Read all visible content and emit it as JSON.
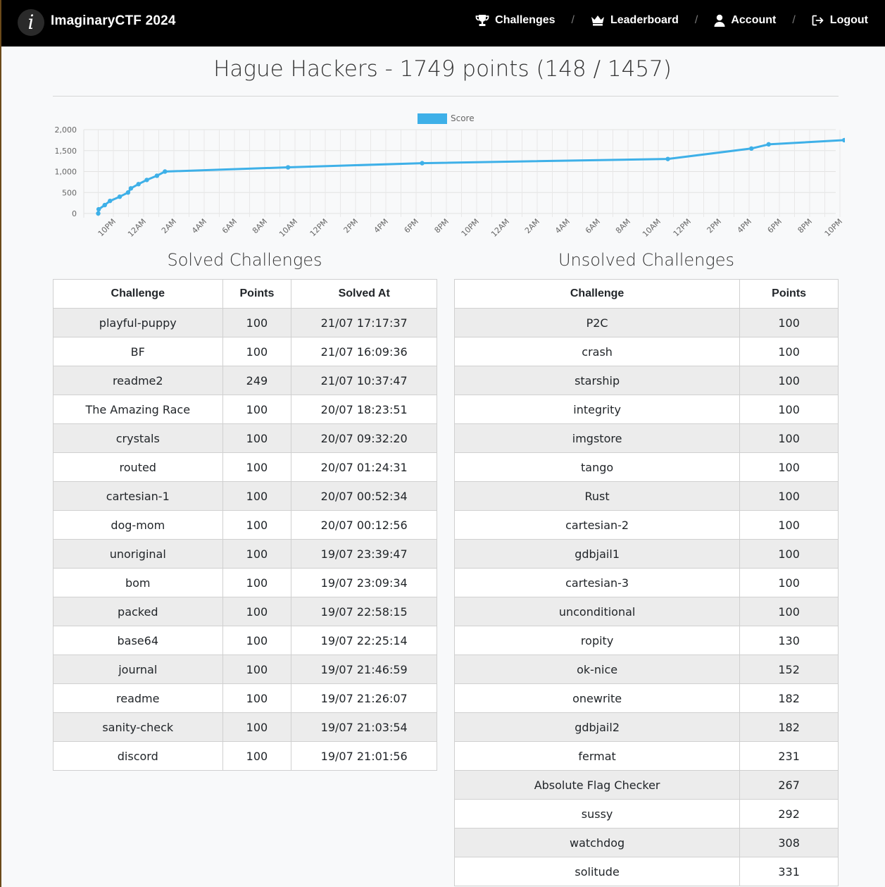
{
  "brand": {
    "logo_letter": "i",
    "name": "ImaginaryCTF 2024"
  },
  "nav": {
    "items": [
      {
        "label": "Challenges",
        "icon": "trophy-icon"
      },
      {
        "label": "Leaderboard",
        "icon": "crown-icon"
      },
      {
        "label": "Account",
        "icon": "user-icon"
      },
      {
        "label": "Logout",
        "icon": "logout-icon"
      }
    ],
    "separator": "/"
  },
  "page_title": "Hague Hackers - 1749 points (148 / 1457)",
  "colors": {
    "line": "#3eb0e8",
    "nav_bg": "#000000"
  },
  "chart_data": {
    "type": "line",
    "legend": [
      "Score"
    ],
    "legend_position": "top-center",
    "grid": true,
    "ylim": [
      0,
      2000
    ],
    "y_ticks": [
      "0",
      "500",
      "1,000",
      "1,500",
      "2,000"
    ],
    "x_ticks": [
      "10PM",
      "12AM",
      "2AM",
      "4AM",
      "6AM",
      "8AM",
      "10AM",
      "12PM",
      "2PM",
      "4PM",
      "6PM",
      "8PM",
      "10PM",
      "12AM",
      "2AM",
      "4AM",
      "6AM",
      "8AM",
      "10AM",
      "12PM",
      "2PM",
      "4PM",
      "6PM",
      "8PM",
      "10PM"
    ],
    "series": [
      {
        "name": "Score",
        "x_hours": [
          21.0,
          21.03,
          21.43,
          21.78,
          22.42,
          22.97,
          23.16,
          23.66,
          24.21,
          24.88,
          25.41,
          33.54,
          42.4,
          58.63,
          64.15,
          65.29,
          70.29
        ],
        "y": [
          0,
          100,
          200,
          300,
          400,
          500,
          600,
          700,
          800,
          900,
          1000,
          1100,
          1200,
          1300,
          1549,
          1649,
          1749
        ]
      }
    ]
  },
  "solved": {
    "heading": "Solved Challenges",
    "columns": [
      "Challenge",
      "Points",
      "Solved At"
    ],
    "rows": [
      [
        "playful-puppy",
        "100",
        "21/07 17:17:37"
      ],
      [
        "BF",
        "100",
        "21/07 16:09:36"
      ],
      [
        "readme2",
        "249",
        "21/07 10:37:47"
      ],
      [
        "The Amazing Race",
        "100",
        "20/07 18:23:51"
      ],
      [
        "crystals",
        "100",
        "20/07 09:32:20"
      ],
      [
        "routed",
        "100",
        "20/07 01:24:31"
      ],
      [
        "cartesian-1",
        "100",
        "20/07 00:52:34"
      ],
      [
        "dog-mom",
        "100",
        "20/07 00:12:56"
      ],
      [
        "unoriginal",
        "100",
        "19/07 23:39:47"
      ],
      [
        "bom",
        "100",
        "19/07 23:09:34"
      ],
      [
        "packed",
        "100",
        "19/07 22:58:15"
      ],
      [
        "base64",
        "100",
        "19/07 22:25:14"
      ],
      [
        "journal",
        "100",
        "19/07 21:46:59"
      ],
      [
        "readme",
        "100",
        "19/07 21:26:07"
      ],
      [
        "sanity-check",
        "100",
        "19/07 21:03:54"
      ],
      [
        "discord",
        "100",
        "19/07 21:01:56"
      ]
    ]
  },
  "unsolved": {
    "heading": "Unsolved Challenges",
    "columns": [
      "Challenge",
      "Points"
    ],
    "rows": [
      [
        "P2C",
        "100"
      ],
      [
        "crash",
        "100"
      ],
      [
        "starship",
        "100"
      ],
      [
        "integrity",
        "100"
      ],
      [
        "imgstore",
        "100"
      ],
      [
        "tango",
        "100"
      ],
      [
        "Rust",
        "100"
      ],
      [
        "cartesian-2",
        "100"
      ],
      [
        "gdbjail1",
        "100"
      ],
      [
        "cartesian-3",
        "100"
      ],
      [
        "unconditional",
        "100"
      ],
      [
        "ropity",
        "130"
      ],
      [
        "ok-nice",
        "152"
      ],
      [
        "onewrite",
        "182"
      ],
      [
        "gdbjail2",
        "182"
      ],
      [
        "fermat",
        "231"
      ],
      [
        "Absolute Flag Checker",
        "267"
      ],
      [
        "sussy",
        "292"
      ],
      [
        "watchdog",
        "308"
      ],
      [
        "solitude",
        "331"
      ]
    ]
  }
}
